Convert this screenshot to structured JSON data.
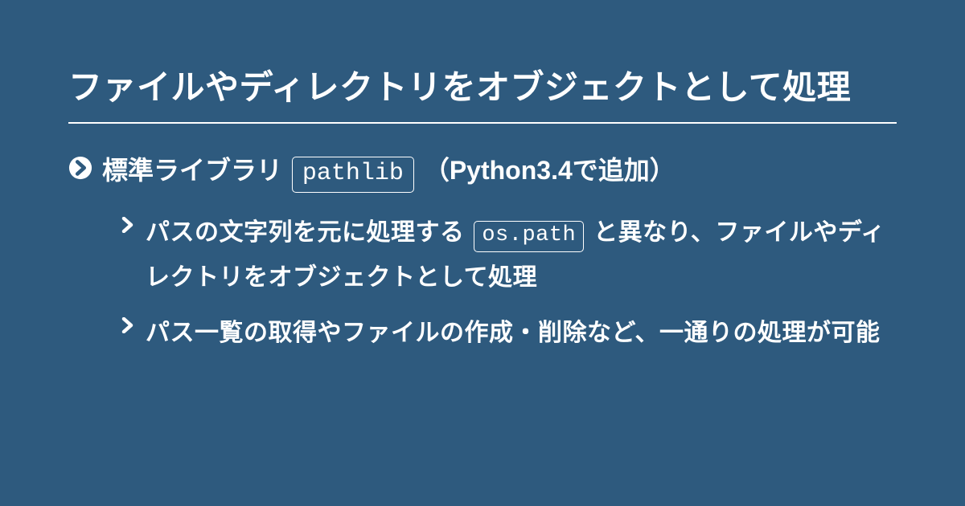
{
  "title": "ファイルやディレクトリをオブジェクトとして処理",
  "main": {
    "prefix": "標準ライブラリ ",
    "code": "pathlib",
    "suffix": " （Python3.4で追加）"
  },
  "sub1": {
    "prefix": "パスの文字列を元に処理する ",
    "code": "os.path",
    "suffix": " と異なり、ファイルやディレクトリをオブジェクトとして処理"
  },
  "sub2": {
    "text": "パス一覧の取得やファイルの作成・削除など、一通りの処理が可能"
  }
}
